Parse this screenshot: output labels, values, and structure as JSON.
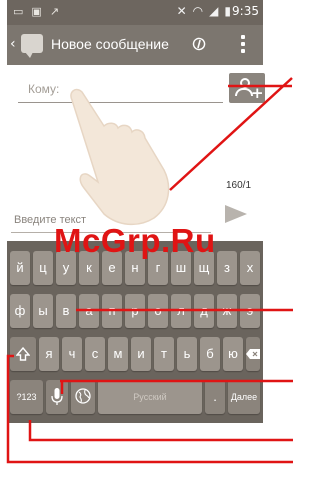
{
  "status_bar": {
    "time": "9:35",
    "left_icons": [
      "message-icon",
      "image-icon",
      "missed-call-icon"
    ],
    "right_icons": [
      "mute-icon",
      "wifi-icon",
      "signal-icon",
      "battery-icon"
    ]
  },
  "action_bar": {
    "title": "Новое сообщение",
    "icons": [
      "back-chevron-icon",
      "messages-app-icon",
      "paperclip-icon",
      "overflow-menu-icon"
    ]
  },
  "compose": {
    "to_placeholder": "Кому:",
    "counter": "160/1",
    "text_placeholder": "Введите текст"
  },
  "keyboard": {
    "row1": [
      "й",
      "ц",
      "у",
      "к",
      "е",
      "н",
      "г",
      "ш",
      "щ",
      "з",
      "х"
    ],
    "row2": [
      "ф",
      "ы",
      "в",
      "а",
      "п",
      "р",
      "о",
      "л",
      "д",
      "ж",
      "э"
    ],
    "row3": [
      "я",
      "ч",
      "с",
      "м",
      "и",
      "т",
      "ь",
      "б",
      "ю"
    ],
    "symbols_label": "?123",
    "space_label": "Русский",
    "period_label": ".",
    "next_label": "Далее"
  },
  "watermark": "McGrp.Ru",
  "colors": {
    "status_bar": "#6d665f",
    "action_bar": "#7c766f",
    "keyboard_bg": "#6a645d",
    "key": "#9c958d",
    "callout_lines": "#e01414"
  }
}
